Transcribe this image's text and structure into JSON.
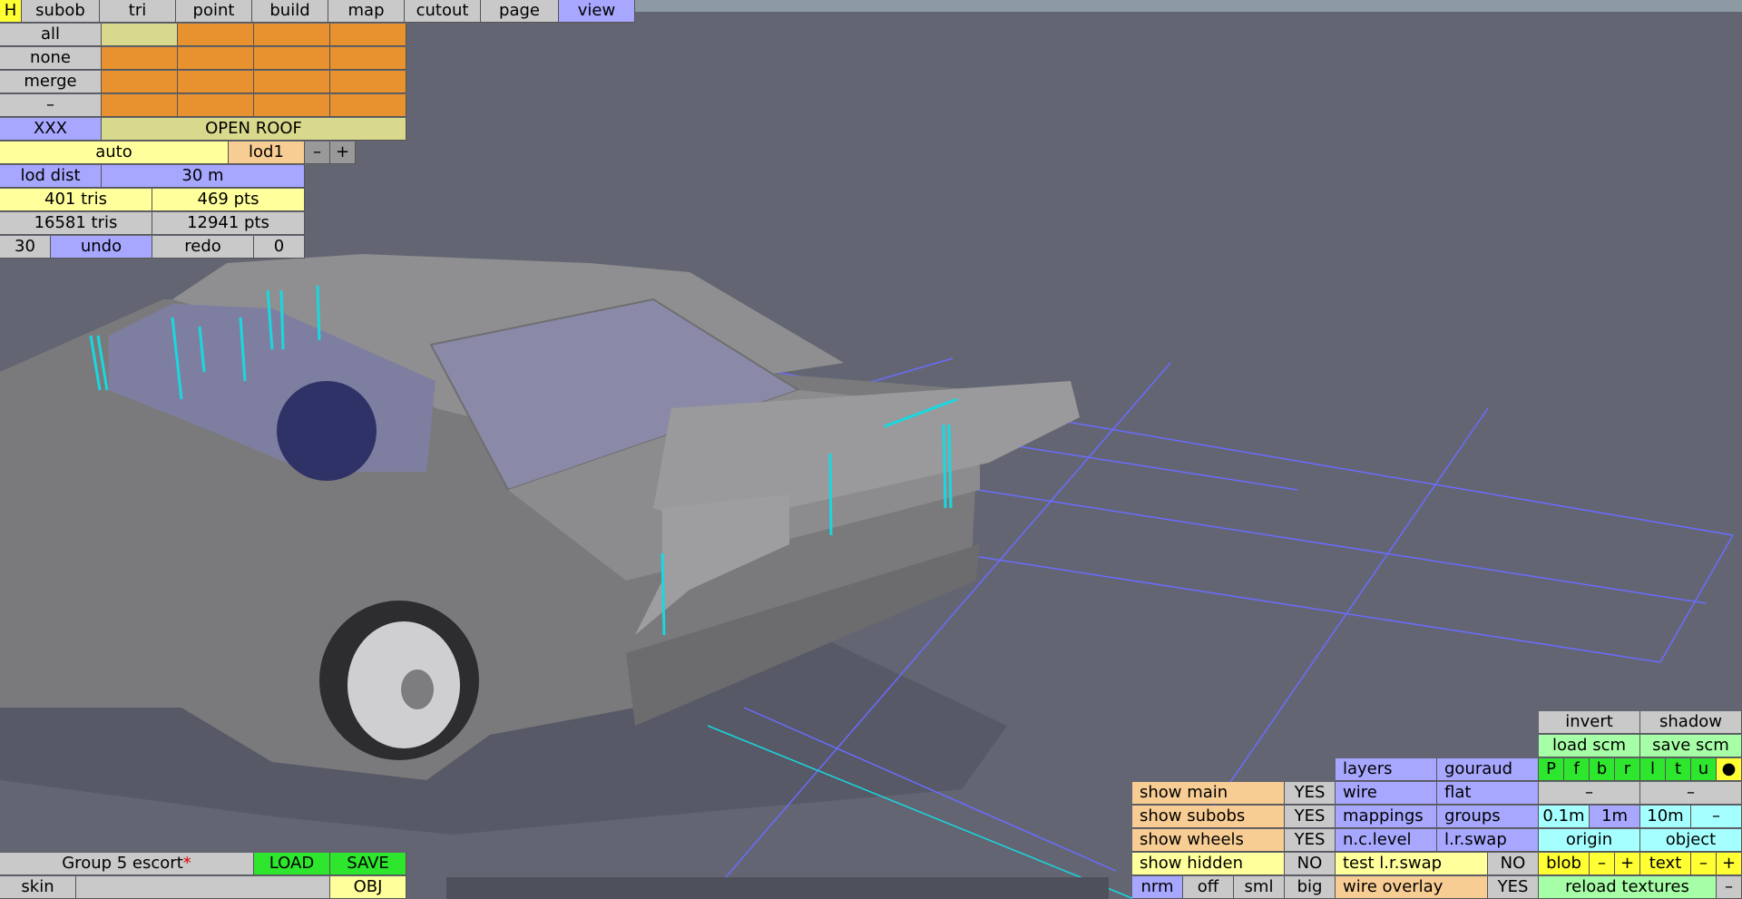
{
  "menu": {
    "h_label": "H",
    "tabs": [
      "subob",
      "tri",
      "point",
      "build",
      "map",
      "cutout",
      "page",
      "view"
    ],
    "active_tab": "view"
  },
  "selection": {
    "all_label": "all",
    "none_label": "none",
    "merge_label": "merge",
    "dash_label": "–"
  },
  "layer": {
    "name": "XXX",
    "open_roof_label": "OPEN ROOF"
  },
  "lod": {
    "auto_label": "auto",
    "current": "lod1",
    "minus": "–",
    "plus": "+",
    "dist_label": "lod dist",
    "dist_value": "30 m"
  },
  "stats": {
    "lod_tris": "401 tris",
    "lod_pts": "469 pts",
    "total_tris": "16581 tris",
    "total_pts": "12941 pts"
  },
  "history": {
    "undo_count": "30",
    "undo_label": "undo",
    "redo_label": "redo",
    "redo_count": "0"
  },
  "file": {
    "name": "Group 5 escort",
    "modified_mark": "*",
    "load_label": "LOAD",
    "save_label": "SAVE",
    "skin_label": "skin",
    "skin_value": "",
    "obj_label": "OBJ"
  },
  "view": {
    "show_main": "show main",
    "show_main_val": "YES",
    "show_subobs": "show subobs",
    "show_subobs_val": "YES",
    "show_wheels": "show wheels",
    "show_wheels_val": "YES",
    "show_hidden": "show hidden",
    "show_hidden_val": "NO",
    "nrm": "nrm",
    "off": "off",
    "sml": "sml",
    "big": "big",
    "layers": "layers",
    "gouraud": "gouraud",
    "wire": "wire",
    "flat": "flat",
    "mappings": "mappings",
    "groups": "groups",
    "nc_level": "n.c.level",
    "lr_swap": "l.r.swap",
    "test_lr_swap": "test l.r.swap",
    "test_lr_swap_val": "NO",
    "wire_overlay": "wire overlay",
    "wire_overlay_val": "YES",
    "invert": "invert",
    "shadow": "shadow",
    "load_scm": "load scm",
    "save_scm": "save scm",
    "dirs": [
      "P",
      "f",
      "b",
      "r",
      "l",
      "t",
      "u",
      "●"
    ],
    "dash": "–",
    "grid_01": "0.1m",
    "grid_1": "1m",
    "grid_10": "10m",
    "origin": "origin",
    "object": "object",
    "blob": "blob",
    "text": "text",
    "minus": "–",
    "plus": "+",
    "reload_textures": "reload textures"
  },
  "colors": {
    "background": "#636672",
    "button_grey": "#c9c9c9",
    "button_yellow": "#ffff9c",
    "button_orange": "#e8912f",
    "button_purple": "#a7a7ff",
    "button_peach": "#f7cd94",
    "button_green": "#2ee62e",
    "grid_lines": "#6b6bff",
    "normal_markers": "#18d8e0"
  }
}
